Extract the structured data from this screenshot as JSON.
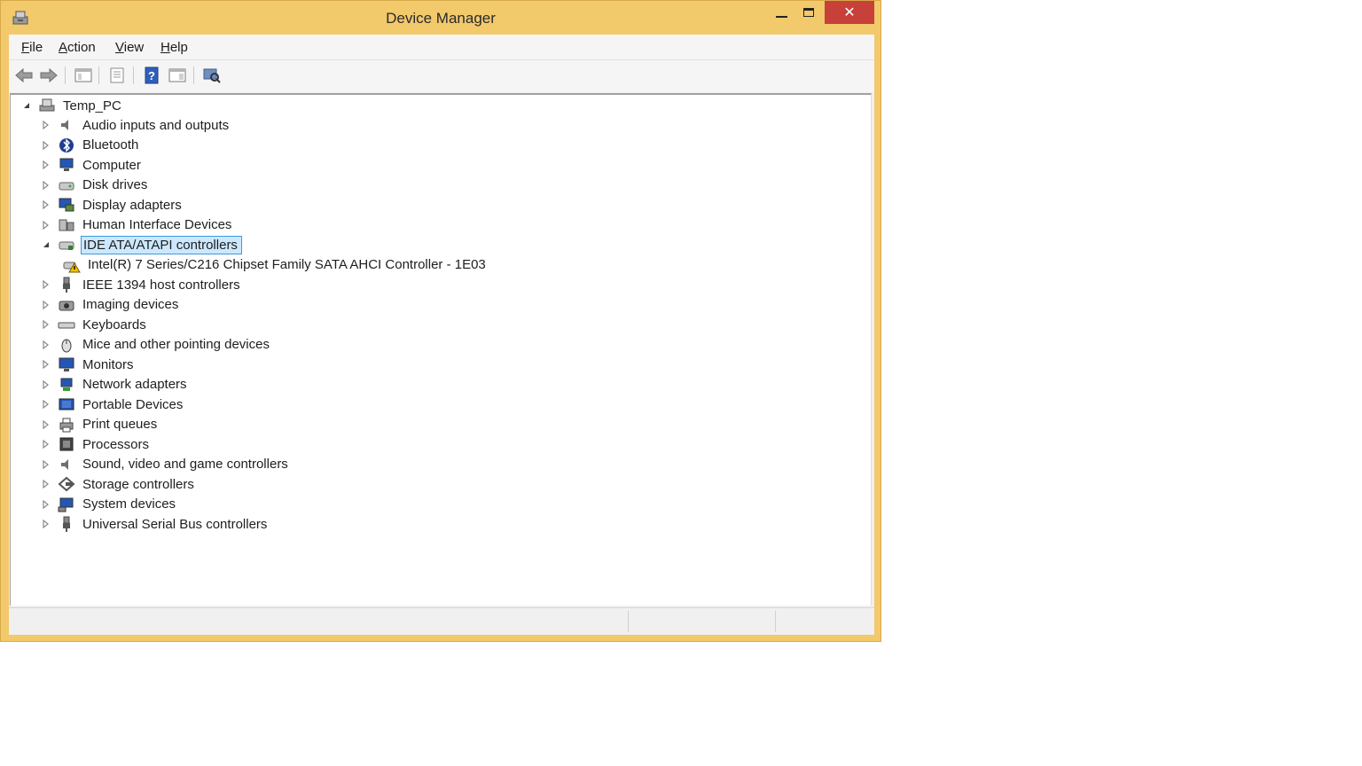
{
  "window": {
    "title": "Device Manager",
    "close_glyph": "✕"
  },
  "menu": [
    {
      "key": "F",
      "rest": "ile"
    },
    {
      "key": "A",
      "rest": "ction"
    },
    {
      "key": "V",
      "rest": "iew"
    },
    {
      "key": "H",
      "rest": "elp"
    }
  ],
  "toolbar_icons": [
    "back-arrow-icon",
    "forward-arrow-icon",
    "show-hide-console-tree-icon",
    "properties-icon",
    "help-icon",
    "action-pane-icon",
    "scan-hardware-changes-icon"
  ],
  "tree": {
    "root": "Temp_PC",
    "categories": [
      "Audio inputs and outputs",
      "Bluetooth",
      "Computer",
      "Disk drives",
      "Display adapters",
      "Human Interface Devices",
      "IDE ATA/ATAPI controllers",
      "Intel(R) 7 Series/C216 Chipset Family SATA AHCI Controller - 1E03",
      "IEEE 1394 host controllers",
      "Imaging devices",
      "Keyboards",
      "Mice and other pointing devices",
      "Monitors",
      "Network adapters",
      "Portable Devices",
      "Print queues",
      "Processors",
      "Sound, video and game controllers",
      "Storage controllers",
      "System devices",
      "Universal Serial Bus controllers"
    ],
    "selected": "IDE ATA/ATAPI controllers"
  },
  "colors": {
    "frame": "#f2c96b",
    "close": "#c7403a",
    "selection": "#cce8ff"
  }
}
